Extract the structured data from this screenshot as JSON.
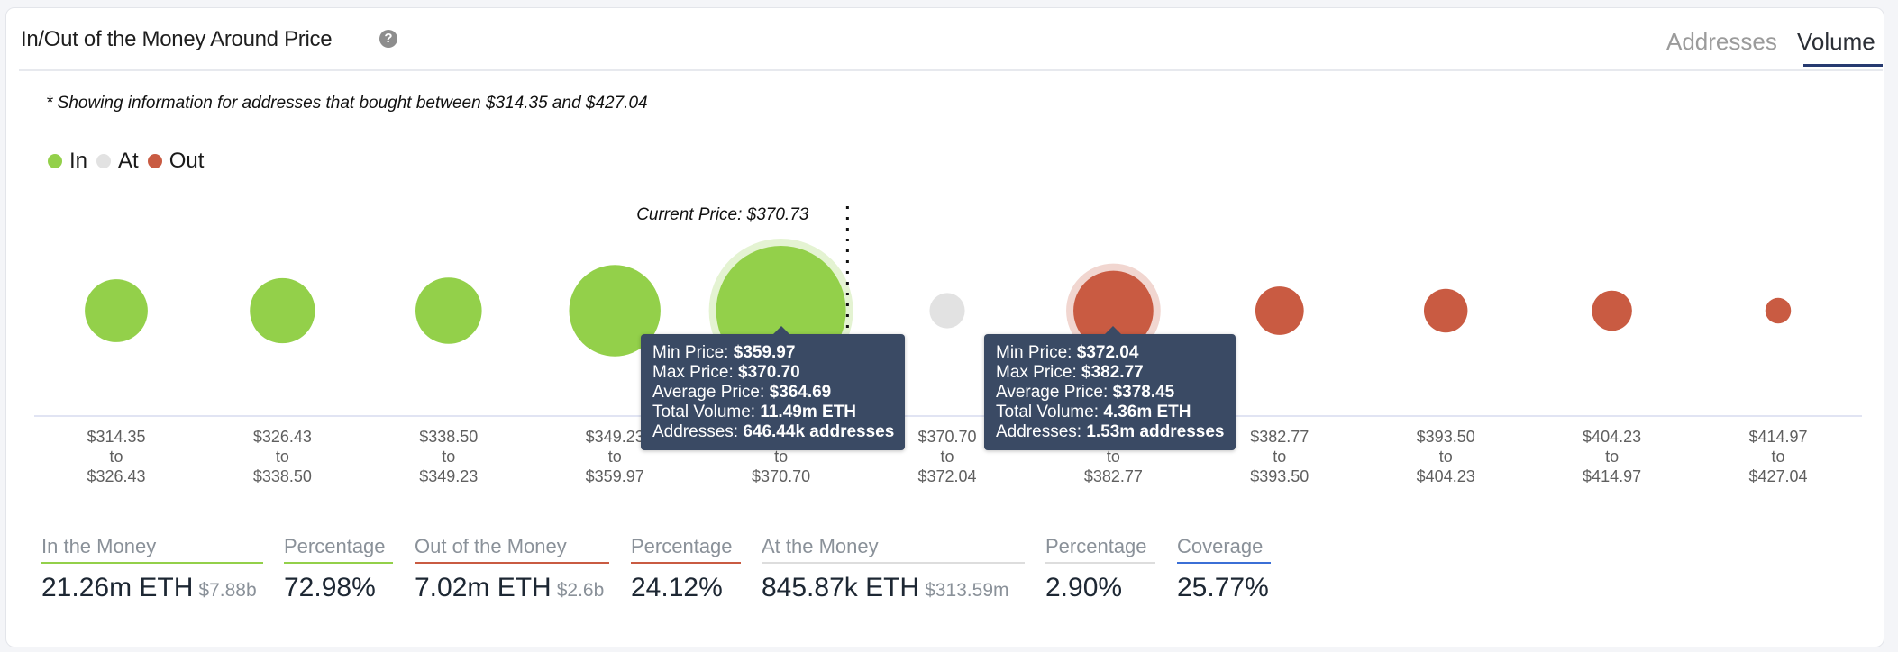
{
  "header": {
    "title": "In/Out of the Money Around Price",
    "help_icon": "question-circle-icon",
    "tabs": [
      {
        "label": "Addresses",
        "active": false
      },
      {
        "label": "Volume",
        "active": true
      }
    ]
  },
  "note": "* Showing information for addresses that bought between $314.35 and $427.04",
  "legend": [
    {
      "label": "In",
      "color": "#93d04a"
    },
    {
      "label": "At",
      "color": "#e2e2e2"
    },
    {
      "label": "Out",
      "color": "#c95b42"
    }
  ],
  "chart_data": {
    "type": "scatter",
    "subtype": "bubble",
    "title": "In/Out of the Money Around Price",
    "measure": "Volume (ETH)",
    "current_price_label": "Current Price: $370.73",
    "current_price": 370.73,
    "current_price_after_bucket_index": 4,
    "legend_placement": "top-left",
    "grid": false,
    "colors": {
      "In": "#93d04a",
      "At": "#e2e2e2",
      "Out": "#c95b42"
    },
    "buckets": [
      {
        "min": "$314.35",
        "max": "$326.43",
        "status": "In",
        "volume_m_eth_est": 2.7
      },
      {
        "min": "$326.43",
        "max": "$338.50",
        "status": "In",
        "volume_m_eth_est": 2.9
      },
      {
        "min": "$338.50",
        "max": "$349.23",
        "status": "In",
        "volume_m_eth_est": 3.0
      },
      {
        "min": "$349.23",
        "max": "$359.97",
        "status": "In",
        "volume_m_eth_est": 5.7
      },
      {
        "min": "$359.97",
        "max": "$370.70",
        "status": "In",
        "volume_m_eth": 11.49,
        "highlighted": true
      },
      {
        "min": "$370.70",
        "max": "$372.04",
        "status": "At",
        "volume_m_eth": 0.85
      },
      {
        "min": "$372.04",
        "max": "$382.77",
        "status": "Out",
        "volume_m_eth": 4.36,
        "highlighted": true
      },
      {
        "min": "$382.77",
        "max": "$393.50",
        "status": "Out",
        "volume_m_eth_est": 1.6
      },
      {
        "min": "$393.50",
        "max": "$404.23",
        "status": "Out",
        "volume_m_eth_est": 1.3
      },
      {
        "min": "$404.23",
        "max": "$414.97",
        "status": "Out",
        "volume_m_eth_est": 1.1
      },
      {
        "min": "$414.97",
        "max": "$427.04",
        "status": "Out",
        "volume_m_eth_est": 0.45
      }
    ],
    "tick_connector": "to",
    "tooltips": [
      {
        "bucket_index": 4,
        "lines": [
          {
            "label": "Min Price: ",
            "value": "$359.97"
          },
          {
            "label": "Max Price: ",
            "value": "$370.70"
          },
          {
            "label": "Average Price: ",
            "value": "$364.69"
          },
          {
            "label": "Total Volume: ",
            "value": "11.49m ETH"
          },
          {
            "label": "Addresses: ",
            "value": "646.44k addresses"
          }
        ]
      },
      {
        "bucket_index": 6,
        "lines": [
          {
            "label": "Min Price: ",
            "value": "$372.04"
          },
          {
            "label": "Max Price: ",
            "value": "$382.77"
          },
          {
            "label": "Average Price: ",
            "value": "$378.45"
          },
          {
            "label": "Total Volume: ",
            "value": "4.36m ETH"
          },
          {
            "label": "Addresses: ",
            "value": "1.53m addresses"
          }
        ]
      }
    ]
  },
  "stats": {
    "in_the_money": {
      "label": "In the Money",
      "value": "21.26m ETH",
      "sub": "$7.88b",
      "color": "#93d04a"
    },
    "in_percentage": {
      "label": "Percentage",
      "value": "72.98%",
      "color": "#93d04a"
    },
    "out_of_the_money": {
      "label": "Out of the Money",
      "value": "7.02m ETH",
      "sub": "$2.6b",
      "color": "#c95b42"
    },
    "out_percentage": {
      "label": "Percentage",
      "value": "24.12%",
      "color": "#c95b42"
    },
    "at_the_money": {
      "label": "At the Money",
      "value": "845.87k ETH",
      "sub": "$313.59m",
      "color": "#dddddd"
    },
    "at_percentage": {
      "label": "Percentage",
      "value": "2.90%",
      "color": "#dddddd"
    },
    "coverage": {
      "label": "Coverage",
      "value": "25.77%",
      "color": "#3b6fd6"
    }
  }
}
